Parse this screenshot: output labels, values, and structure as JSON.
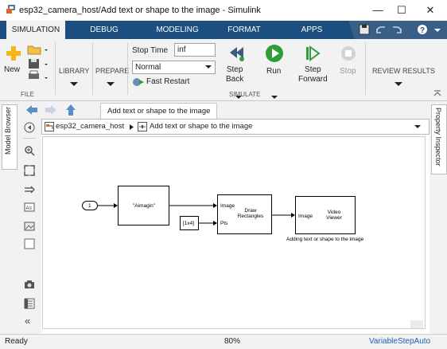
{
  "window": {
    "title": "esp32_camera_host/Add text or shape to the image - Simulink",
    "minimize": "—",
    "maximize": "☐",
    "close": "✕",
    "icon": "simulink-icon"
  },
  "tabs": [
    {
      "label": "SIMULATION",
      "active": true
    },
    {
      "label": "DEBUG",
      "active": false
    },
    {
      "label": "MODELING",
      "active": false
    },
    {
      "label": "FORMAT",
      "active": false
    },
    {
      "label": "APPS",
      "active": false
    }
  ],
  "ribbon": {
    "file": {
      "new_label": "New",
      "group": "FILE"
    },
    "library_label": "LIBRARY",
    "prepare_label": "PREPARE",
    "stop_time_label": "Stop Time",
    "stop_time_value": "inf",
    "mode_value": "Normal",
    "fast_restart_label": "Fast Restart",
    "step_back_label": "Step\nBack",
    "run_label": "Run",
    "step_forward_label": "Step\nForward",
    "stop_label": "Stop",
    "simulate_group": "SIMULATE",
    "review_results_label": "REVIEW RESULTS"
  },
  "left_panel": {
    "model_browser": "Model Browser"
  },
  "right_panel": {
    "property_inspector": "Property Inspector"
  },
  "model_tab": "Add text or shape to the image",
  "breadcrumb": {
    "root": "esp32_camera_host",
    "current": "Add text or shape to the image"
  },
  "diagram": {
    "inport": "1",
    "const_block": "\"Aimagin\"",
    "draw_in_image": "Image",
    "draw_in_pts": "Pts",
    "draw_title": "Draw\nRectangles",
    "const_1x4": "[1x4]",
    "viewer_in": "Image",
    "viewer_title": "Video\nViewer",
    "viewer_caption": "Adding text or shape to the image"
  },
  "status": {
    "left": "Ready",
    "zoom": "80%",
    "solver": "VariableStepAuto"
  },
  "colors": {
    "accent": "#1c4e80",
    "run_green": "#2e9d3a",
    "link_blue": "#1a5fb4"
  }
}
